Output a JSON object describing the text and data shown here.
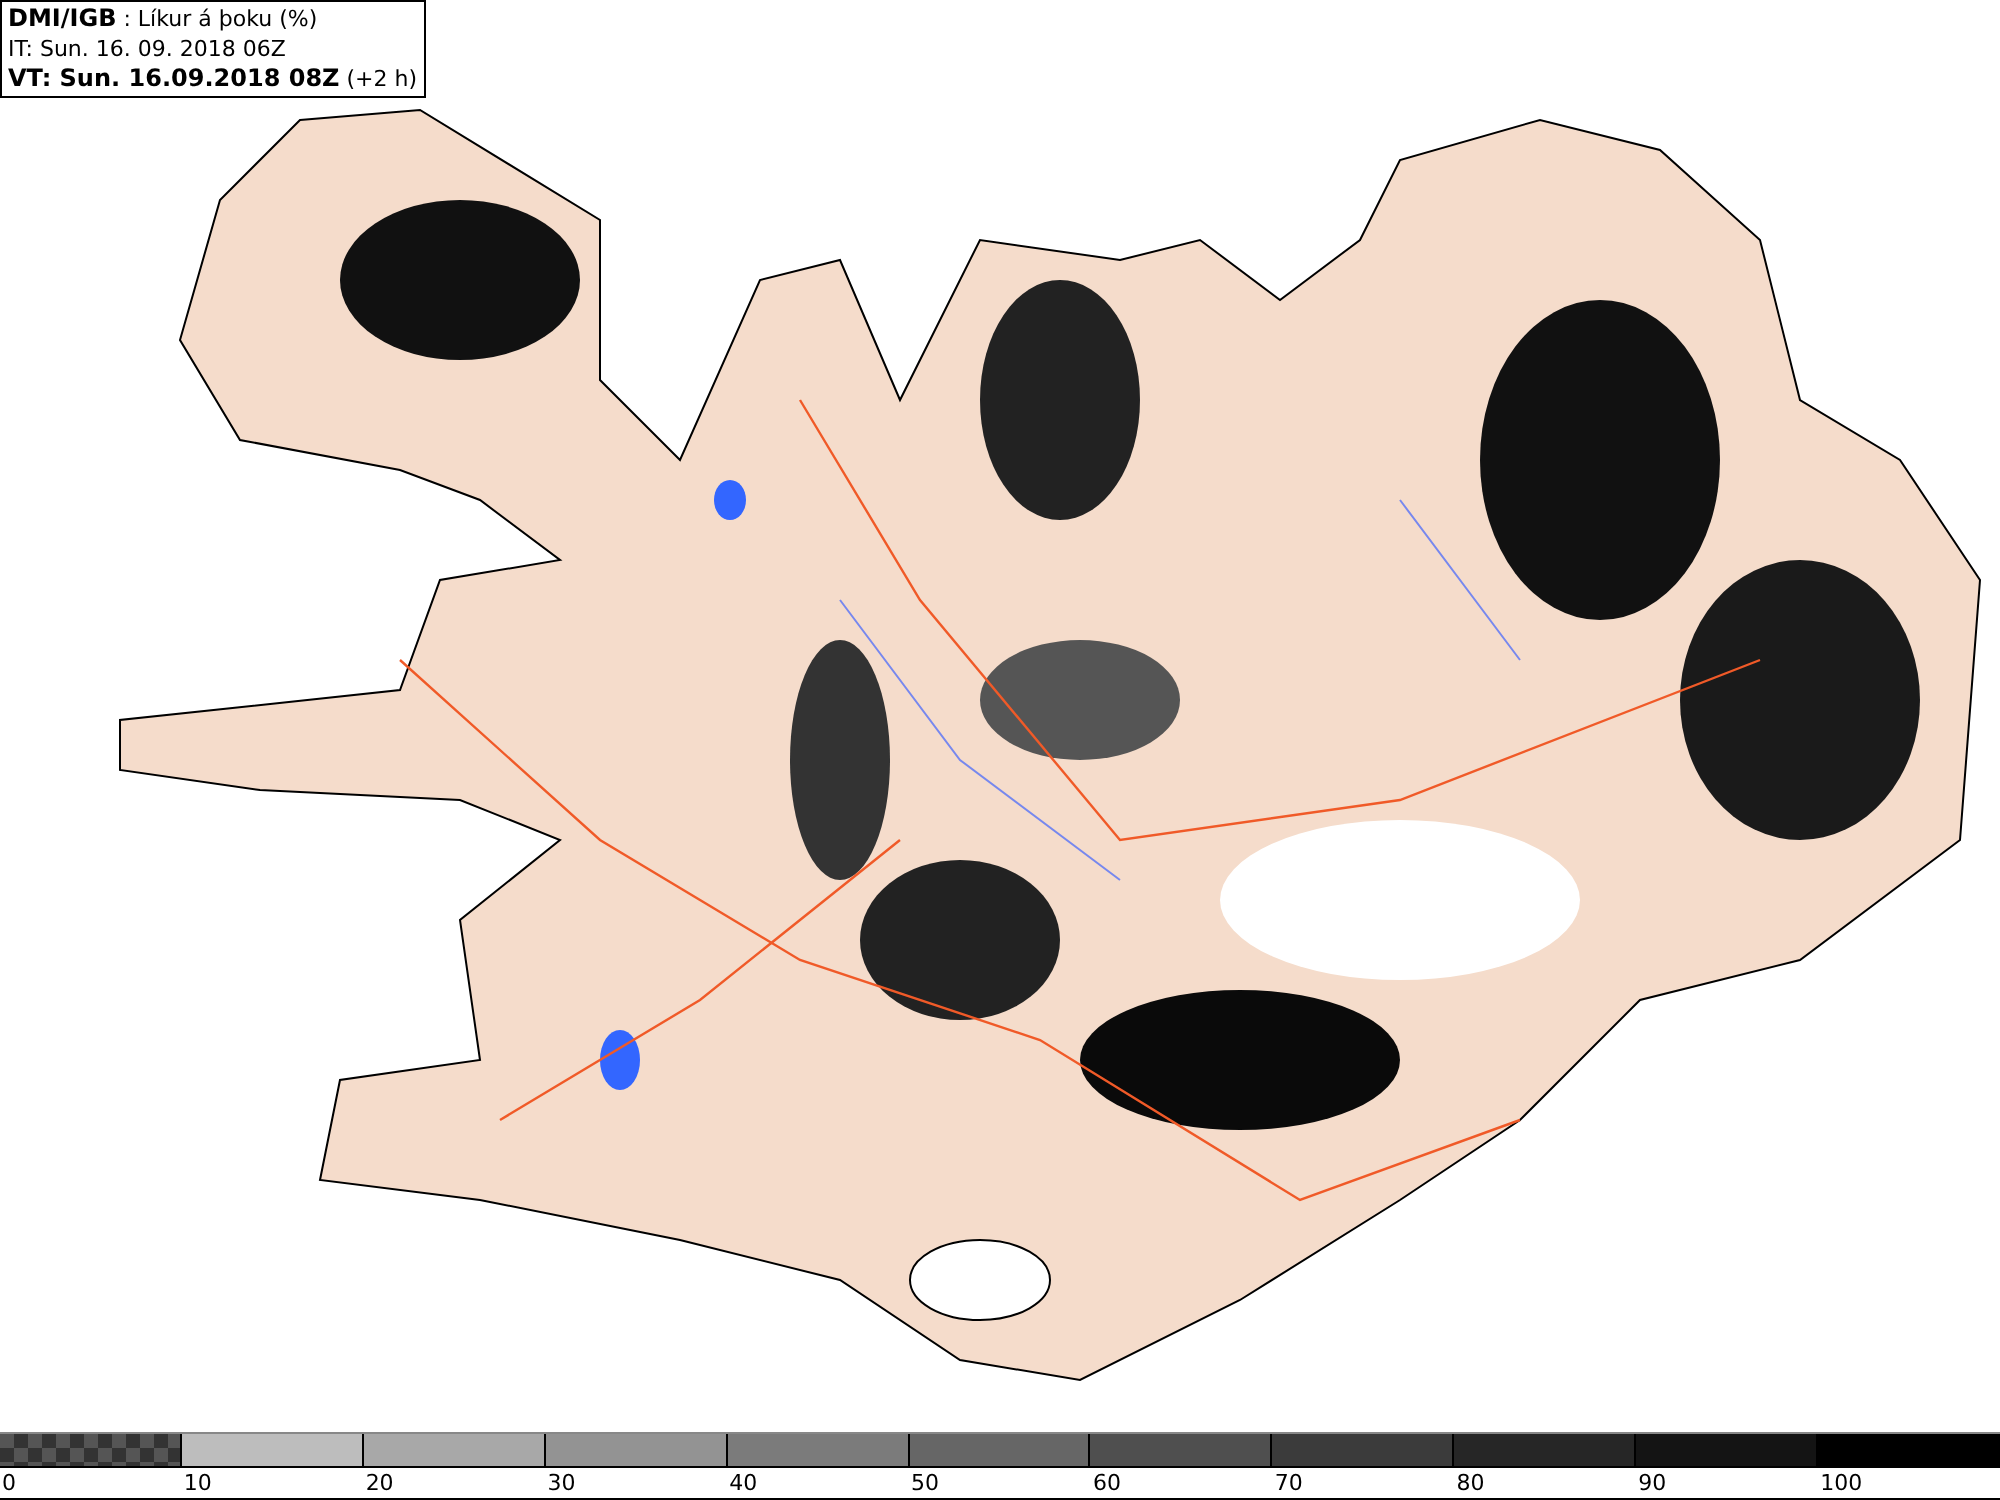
{
  "info_box": {
    "lines": [
      "**DMI/IGB** : Líkur á þoku (%)",
      "IT: Sun. 16. 09. 2018 06Z",
      "**VT: Sun. 16.09.2018 08Z** (+2 h)"
    ]
  },
  "legend": {
    "segments": [
      {
        "kind": "checker",
        "color": "#555555"
      },
      {
        "kind": "solid",
        "color": "#bdbdbd"
      },
      {
        "kind": "solid",
        "color": "#a8a8a8"
      },
      {
        "kind": "solid",
        "color": "#939393"
      },
      {
        "kind": "solid",
        "color": "#7b7b7b"
      },
      {
        "kind": "solid",
        "color": "#666666"
      },
      {
        "kind": "solid",
        "color": "#4f4f4f"
      },
      {
        "kind": "solid",
        "color": "#3b3b3b"
      },
      {
        "kind": "solid",
        "color": "#262626"
      },
      {
        "kind": "solid",
        "color": "#141414"
      },
      {
        "kind": "solid",
        "color": "#000000"
      }
    ],
    "labels": [
      "0",
      "10",
      "20",
      "30",
      "40",
      "50",
      "60",
      "70",
      "80",
      "90",
      "100"
    ]
  }
}
